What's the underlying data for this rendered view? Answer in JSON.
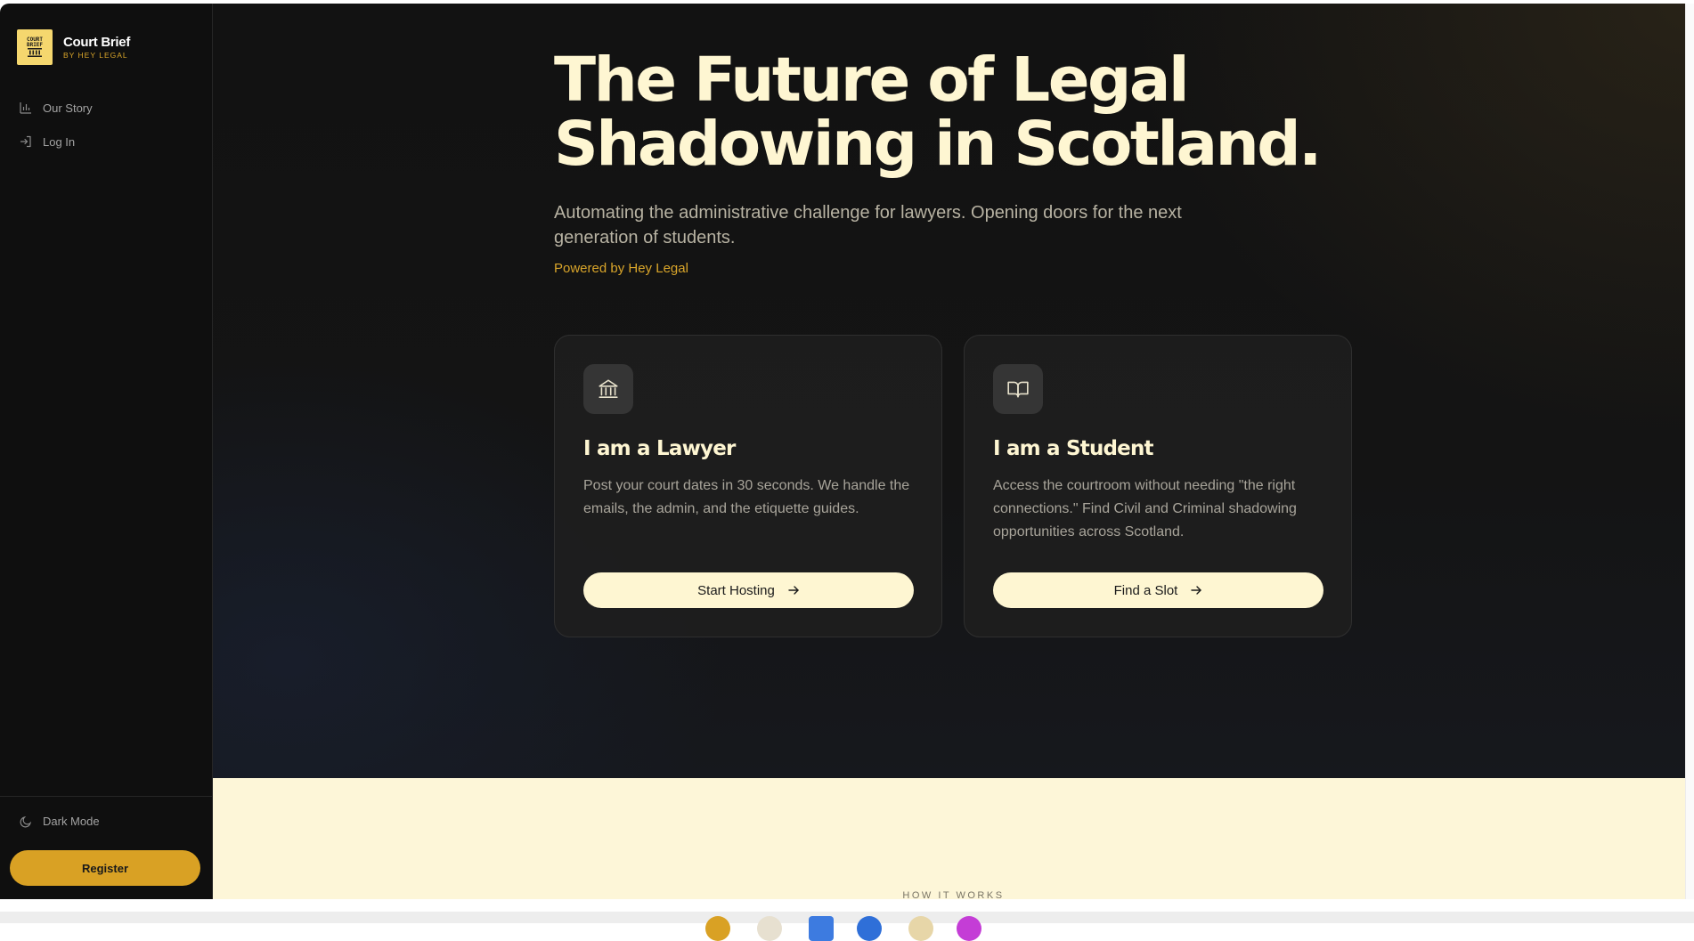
{
  "brand": {
    "logo_text": "COURT\nBRIEF",
    "name": "Court Brief",
    "subtitle": "BY HEY LEGAL"
  },
  "nav": {
    "items": [
      {
        "label": "Our Story",
        "icon": "bar-chart-icon"
      },
      {
        "label": "Log In",
        "icon": "log-in-icon"
      }
    ]
  },
  "sidebar_footer": {
    "dark_mode_label": "Dark Mode",
    "register_label": "Register"
  },
  "hero": {
    "title_line1": "The Future of Legal",
    "title_line2": "Shadowing in Scotland.",
    "subtitle": "Automating the administrative challenge for lawyers. Opening doors for the next generation of students.",
    "powered_by": "Powered by Hey Legal"
  },
  "cards": [
    {
      "icon": "courthouse-icon",
      "title": "I am a Lawyer",
      "description": "Post your court dates in 30 seconds. We handle the emails, the admin, and the etiquette guides.",
      "button": "Start Hosting"
    },
    {
      "icon": "open-book-icon",
      "title": "I am a Student",
      "description": "Access the courtroom without needing \"the right connections.\" Find Civil and Criminal shadowing opportunities across Scotland.",
      "button": "Find a Slot"
    }
  ],
  "section": {
    "how_it_works_label": "HOW IT WORKS"
  },
  "colors": {
    "accent": "#d9a124",
    "hero_text": "#fef6d2",
    "cream_bg": "#fdf6d8",
    "sidebar_bg": "#0f0f0f"
  }
}
